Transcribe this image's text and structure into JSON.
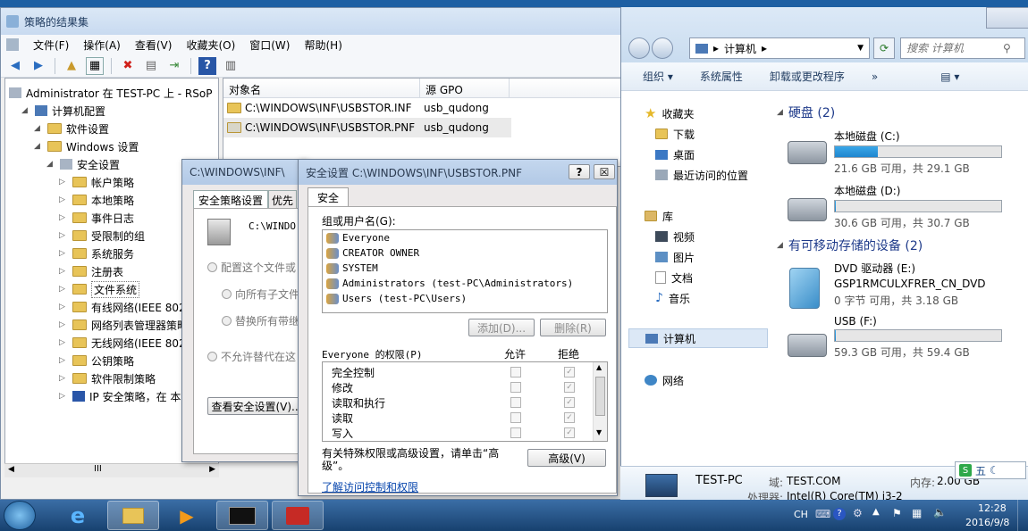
{
  "rsop": {
    "title": "策略的结果集",
    "menu": [
      "文件(F)",
      "操作(A)",
      "查看(V)",
      "收藏夹(O)",
      "窗口(W)",
      "帮助(H)"
    ],
    "tree": [
      {
        "label": "Administrator 在 TEST-PC 上 - RSoP",
        "level": 0,
        "icon": "rsop-icon"
      },
      {
        "label": "计算机配置",
        "level": 1,
        "icon": "computer-icon"
      },
      {
        "label": "软件设置",
        "level": 2,
        "icon": "folder-icon"
      },
      {
        "label": "Windows 设置",
        "level": 2,
        "icon": "folder-icon"
      },
      {
        "label": "安全设置",
        "level": 3,
        "icon": "security-icon"
      },
      {
        "label": "帐户策略",
        "level": 4,
        "icon": "folder-icon"
      },
      {
        "label": "本地策略",
        "level": 4,
        "icon": "folder-icon"
      },
      {
        "label": "事件日志",
        "level": 4,
        "icon": "folder-icon"
      },
      {
        "label": "受限制的组",
        "level": 4,
        "icon": "folder-icon"
      },
      {
        "label": "系统服务",
        "level": 4,
        "icon": "folder-icon"
      },
      {
        "label": "注册表",
        "level": 4,
        "icon": "folder-icon"
      },
      {
        "label": "文件系统",
        "level": 4,
        "icon": "folder-icon"
      },
      {
        "label": "有线网络(IEEE 802",
        "level": 4,
        "icon": "folder-icon"
      },
      {
        "label": "网络列表管理器策略",
        "level": 4,
        "icon": "folder-icon"
      },
      {
        "label": "无线网络(IEEE 802",
        "level": 4,
        "icon": "folder-icon"
      },
      {
        "label": "公钥策略",
        "level": 4,
        "icon": "folder-icon"
      },
      {
        "label": "软件限制策略",
        "level": 4,
        "icon": "folder-icon"
      },
      {
        "label": "IP 安全策略，在 本",
        "level": 4,
        "icon": "ipsec-icon"
      }
    ],
    "scroll_label": "III",
    "list": {
      "columns": [
        "对象名",
        "源 GPO"
      ],
      "rows": [
        {
          "name": "C:\\WINDOWS\\INF\\USBSTOR.INF",
          "gpo": "usb_qudong"
        },
        {
          "name": "C:\\WINDOWS\\INF\\USBSTOR.PNF",
          "gpo": "usb_qudong"
        }
      ]
    }
  },
  "props_dialog": {
    "title": "C:\\WINDOWS\\INF\\",
    "tabs": [
      "安全策略设置",
      "优先"
    ],
    "path": "C:\\WINDO",
    "radio_configure": "配置这个文件或",
    "radio_propagate": "向所有子文件",
    "radio_replace": "替换所有带继",
    "radio_disallow": "不允许替代在这",
    "view_security_button": "查看安全设置(V)..."
  },
  "security_dialog": {
    "title": "安全设置 C:\\WINDOWS\\INF\\USBSTOR.PNF",
    "help_button": "?",
    "close_button": "☒",
    "tab": "安全",
    "group_label": "组或用户名(G):",
    "users": [
      "Everyone",
      "CREATOR OWNER",
      "SYSTEM",
      "Administrators (test-PC\\Administrators)",
      "Users (test-PC\\Users)"
    ],
    "add_button": "添加(D)...",
    "remove_button": "删除(R)",
    "perm_label": "Everyone 的权限(P)",
    "allow_label": "允许",
    "deny_label": "拒绝",
    "permissions": [
      {
        "name": "完全控制",
        "allow": false,
        "deny": true
      },
      {
        "name": "修改",
        "allow": false,
        "deny": true
      },
      {
        "name": "读取和执行",
        "allow": false,
        "deny": true
      },
      {
        "name": "读取",
        "allow": false,
        "deny": true
      },
      {
        "name": "写入",
        "allow": false,
        "deny": true
      }
    ],
    "special_text": "有关特殊权限或高级设置，请单击“高级”。",
    "advanced_button": "高级(V)",
    "link_text": "了解访问控制和权限"
  },
  "explorer": {
    "breadcrumb": "计算机",
    "search_placeholder": "搜索 计算机",
    "commands": [
      "组织 ▾",
      "系统属性",
      "卸载或更改程序",
      "»"
    ],
    "nav": {
      "favorites": "收藏夹",
      "fav_items": [
        "下载",
        "桌面",
        "最近访问的位置"
      ],
      "libraries": "库",
      "lib_items": [
        "视频",
        "图片",
        "文档",
        "音乐"
      ],
      "computer": "计算机",
      "network": "网络"
    },
    "hdd_group": "硬盘 (2)",
    "removable_group": "有可移动存储的设备 (2)",
    "drives": [
      {
        "name": "本地磁盘 (C:)",
        "caption": "21.6 GB 可用，共 29.1 GB",
        "used_fraction": 0.26
      },
      {
        "name": "本地磁盘 (D:)",
        "caption": "30.6 GB 可用，共 30.7 GB",
        "used_fraction": 0.003
      },
      {
        "name": "DVD 驱动器 (E:)",
        "sub": "GSP1RMCULXFRER_CN_DVD",
        "caption": "0 字节 可用，共 3.18 GB"
      },
      {
        "name": "USB (F:)",
        "caption": "59.3 GB 可用，共 59.4 GB",
        "used_fraction": 0.002
      }
    ],
    "details": {
      "pc_name": "TEST-PC",
      "domain_label": "域:",
      "domain": "TEST.COM",
      "mem_label": "内存:",
      "mem": "2.00 GB",
      "cpu_label": "处理器:",
      "cpu": "Intel(R) Core(TM) i3-2"
    },
    "ime": "五"
  },
  "taskbar": {
    "lang": "CH",
    "time": "12:28",
    "date": "2016/9/8"
  },
  "colors": {
    "taskbar": "#1d4f86",
    "accent": "#1e3a8a",
    "link": "#0645ad",
    "drive_bar": "#1f86cf"
  }
}
